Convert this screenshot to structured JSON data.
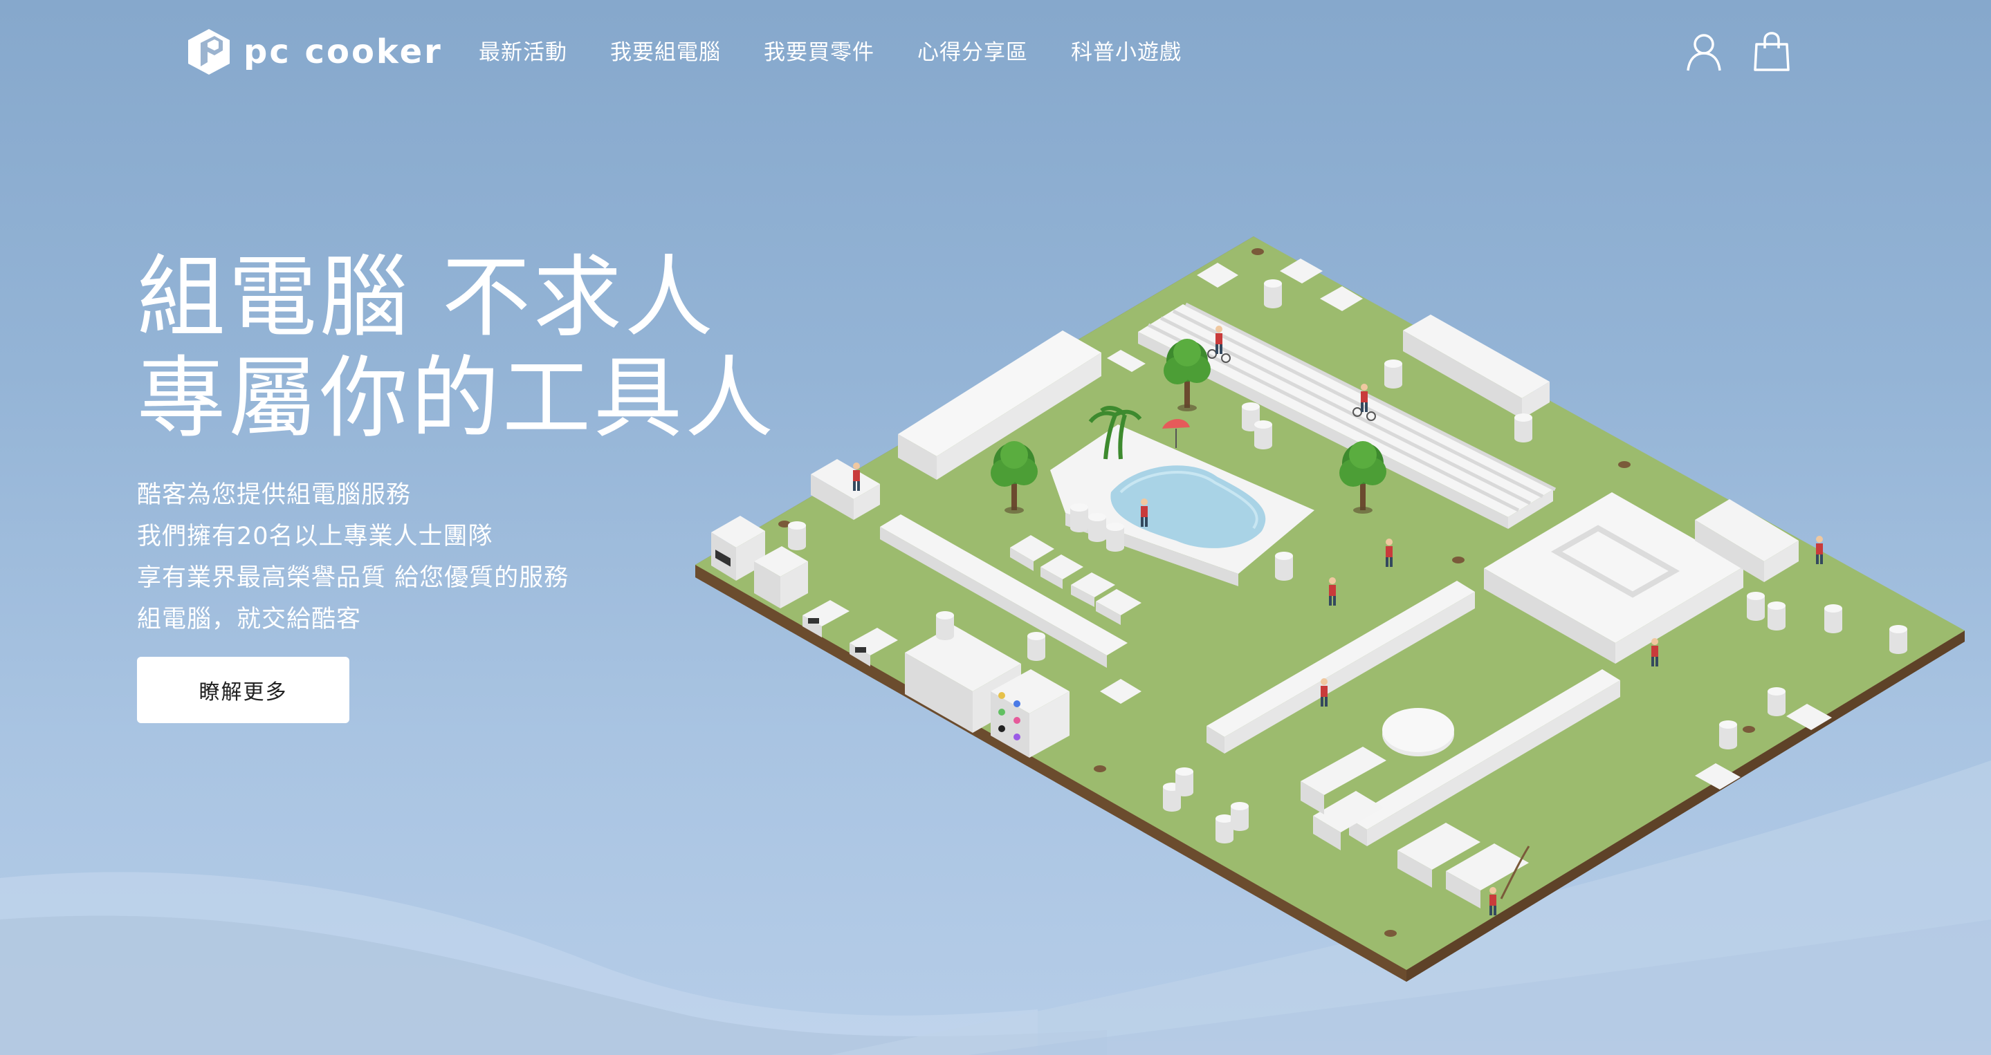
{
  "brand": {
    "name": "pc cooker"
  },
  "nav": {
    "items": [
      {
        "label": "最新活動"
      },
      {
        "label": "我要組電腦"
      },
      {
        "label": "我要買零件"
      },
      {
        "label": "心得分享區"
      },
      {
        "label": "科普小遊戲"
      }
    ],
    "icons": [
      "user-icon",
      "shopping-bag-icon"
    ]
  },
  "hero": {
    "title_line1": "組電腦 不求人",
    "title_line2": "專屬你的工具人",
    "lines": [
      "酷客為您提供組電腦服務",
      "我們擁有20名以上專業人士團隊",
      "享有業界最高榮譽品質 給您優質的服務",
      "組電腦，就交給酷客"
    ],
    "cta_label": "瞭解更多"
  },
  "colors": {
    "background": "#94b4d6",
    "board_green": "#9cbb6e",
    "board_edge": "#7a5a3a",
    "component_white": "#eeeeee",
    "pool": "#a9d3e6"
  }
}
